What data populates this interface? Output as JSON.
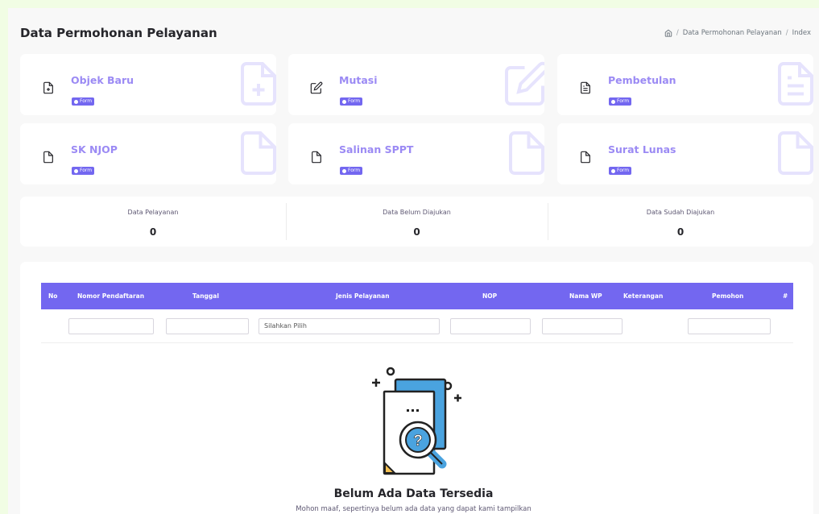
{
  "header": {
    "title": "Data Permohonan Pelayanan",
    "breadcrumb": [
      "Data Permohonan Pelayanan",
      "Index"
    ]
  },
  "services": [
    {
      "title": "Objek Baru",
      "badge": "Form",
      "icon": "file-plus-icon"
    },
    {
      "title": "Mutasi",
      "badge": "Form",
      "icon": "edit-icon"
    },
    {
      "title": "Pembetulan",
      "badge": "Form",
      "icon": "file-text-icon"
    },
    {
      "title": "SK NJOP",
      "badge": "Form",
      "icon": "file-icon"
    },
    {
      "title": "Salinan SPPT",
      "badge": "Form",
      "icon": "file-icon"
    },
    {
      "title": "Surat Lunas",
      "badge": "Form",
      "icon": "file-icon"
    }
  ],
  "stats": [
    {
      "label": "Data Pelayanan",
      "value": "0"
    },
    {
      "label": "Data Belum Diajukan",
      "value": "0"
    },
    {
      "label": "Data Sudah Diajukan",
      "value": "0"
    }
  ],
  "table": {
    "columns": [
      "No",
      "Nomor Pendaftaran",
      "Tanggal",
      "Jenis Pelayanan",
      "NOP",
      "Nama WP",
      "Keterangan",
      "Pemohon",
      "#"
    ],
    "filter_select_value": "Silahkan Pilih"
  },
  "empty": {
    "title": "Belum Ada Data Tersedia",
    "message": "Mohon maaf, sepertinya belum ada data yang dapat kami tampilkan"
  },
  "colors": {
    "accent": "#7367f0",
    "accent_light": "#9b8af4",
    "background": "#f1fde4"
  }
}
